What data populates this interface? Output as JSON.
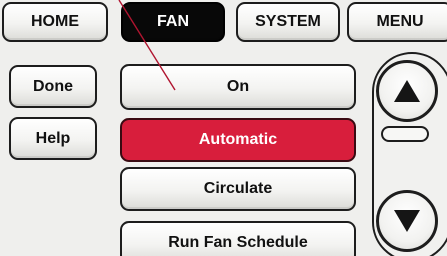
{
  "tabs": [
    "HOME",
    "FAN",
    "SYSTEM",
    "MENU"
  ],
  "active_tab": "FAN",
  "side_buttons": {
    "done": "Done",
    "help": "Help"
  },
  "fan_options": [
    "On",
    "Automatic",
    "Circulate",
    "Run Fan Schedule"
  ],
  "selected_option": "Automatic",
  "icons": {
    "up": "up-arrow-icon",
    "down": "down-arrow-icon"
  },
  "colors": {
    "selected": "#d81e3c",
    "active_tab": "#080808",
    "background": "#efefed",
    "pointer_line": "#b01530"
  }
}
